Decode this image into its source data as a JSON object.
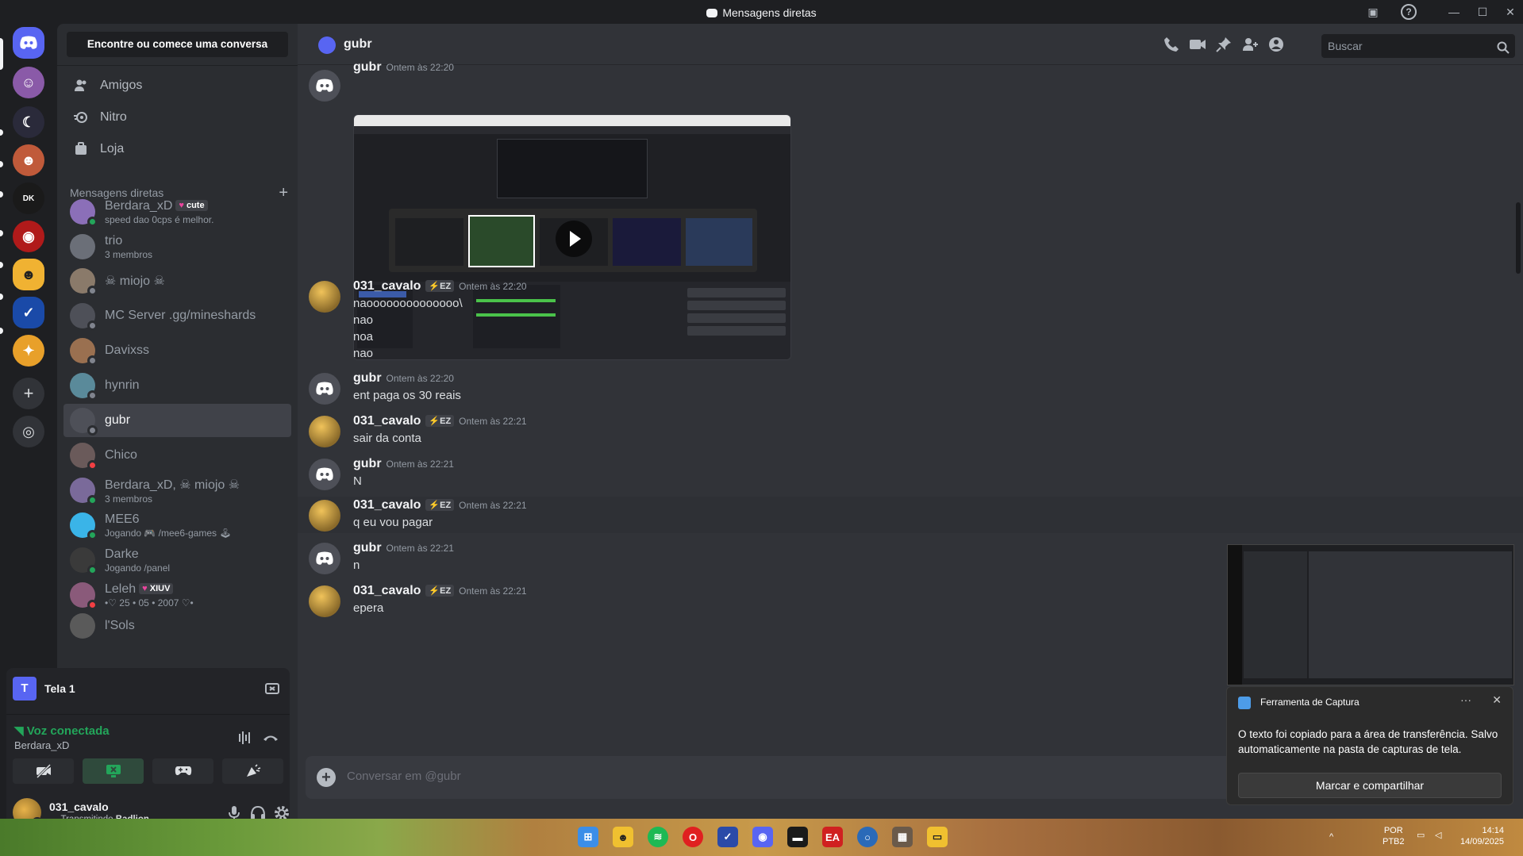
{
  "window": {
    "title": "Mensagens diretas"
  },
  "sidebar": {
    "find_label": "Encontre ou comece uma conversa",
    "nav": [
      {
        "label": "Amigos",
        "icon": "friends-icon"
      },
      {
        "label": "Nitro",
        "icon": "nitro-icon"
      },
      {
        "label": "Loja",
        "icon": "shop-icon"
      }
    ],
    "dm_header": "Mensagens diretas",
    "dms": [
      {
        "name": "Berdara_xD",
        "tag": "cute",
        "sub": "speed dao 0cps é melhor.",
        "status": "online",
        "color": "#8b6fb8"
      },
      {
        "name": "trio",
        "sub": "3 membros",
        "color": "#6b6f78"
      },
      {
        "name": "☠ miojo ☠",
        "sub": "",
        "status": "offline",
        "color": "#8a7a6a"
      },
      {
        "name": "MC Server .gg/mineshards",
        "sub": "",
        "status": "offline",
        "color": "#4e5058"
      },
      {
        "name": "Davixss",
        "sub": "",
        "status": "offline",
        "color": "#9a7050"
      },
      {
        "name": "hynrin",
        "sub": "",
        "status": "offline",
        "color": "#5a8a9a"
      },
      {
        "name": "gubr",
        "sub": "",
        "status": "offline",
        "color": "#4e5058"
      },
      {
        "name": "Chico",
        "sub": "",
        "status": "dnd",
        "color": "#6a5a5a"
      },
      {
        "name": "Berdara_xD, ☠ miojo ☠",
        "sub": "3 membros",
        "status": "online",
        "color": "#7a6a9a"
      },
      {
        "name": "MEE6",
        "sub": "Jogando 🎮 /mee6-games 🕹",
        "status": "online",
        "color": "#3ab4e8"
      },
      {
        "name": "Darke",
        "sub": "Jogando /panel",
        "status": "online",
        "color": "#3a3a3a"
      },
      {
        "name": "Leleh",
        "tag": "XIUV",
        "sub": "•♡ 25 • 05 • 2007 ♡•",
        "status": "dnd",
        "color": "#8a5a7a"
      },
      {
        "name": "l'Sols",
        "sub": "",
        "color": "#5a5a5a"
      }
    ]
  },
  "voice": {
    "stream_label": "Tela 1",
    "stream_icon_letter": "T",
    "status": "Voz conectada",
    "channel": "Berdara_xD",
    "user": {
      "name": "031_cavalo",
      "status_prefix": "Transmitindo",
      "status_app": "Badlion"
    }
  },
  "chat": {
    "recipient": "gubr",
    "search_placeholder": "Buscar",
    "composer_placeholder": "Conversar em @gubr",
    "attachment_author": "gubr",
    "attachment_time": "Ontem às 22:20",
    "messages": [
      {
        "author": "031_cavalo",
        "badge": "EZ",
        "time": "Ontem às 22:20",
        "lines": [
          "naoooooooooooooo\\",
          "nao",
          "noa",
          "nao"
        ],
        "avatar": "cavalo"
      },
      {
        "author": "gubr",
        "time": "Ontem às 22:20",
        "lines": [
          "ent paga os 30 reais"
        ],
        "avatar": "discord"
      },
      {
        "author": "031_cavalo",
        "badge": "EZ",
        "time": "Ontem às 22:21",
        "lines": [
          "sair da conta"
        ],
        "avatar": "cavalo"
      },
      {
        "author": "gubr",
        "time": "Ontem às 22:21",
        "lines": [
          "N"
        ],
        "avatar": "discord"
      },
      {
        "author": "031_cavalo",
        "badge": "EZ",
        "time": "Ontem às 22:21",
        "lines": [
          "q eu vou pagar"
        ],
        "avatar": "cavalo"
      },
      {
        "author": "gubr",
        "time": "Ontem às 22:21",
        "lines": [
          "n"
        ],
        "avatar": "discord"
      },
      {
        "author": "031_cavalo",
        "badge": "EZ",
        "time": "Ontem às 22:21",
        "lines": [
          "epera"
        ],
        "avatar": "cavalo"
      }
    ]
  },
  "toast": {
    "app": "Ferramenta de Captura",
    "message": "O texto foi copiado para a área de transferência. Salvo automaticamente na pasta de capturas de tela.",
    "button": "Marcar e compartilhar"
  },
  "taskbar": {
    "lang": "POR",
    "layout": "PTB2",
    "time": "14:14",
    "date": "14/09/2025"
  },
  "colors": {
    "accent": "#5865f2",
    "online": "#23a55a",
    "dnd": "#f23f43"
  }
}
